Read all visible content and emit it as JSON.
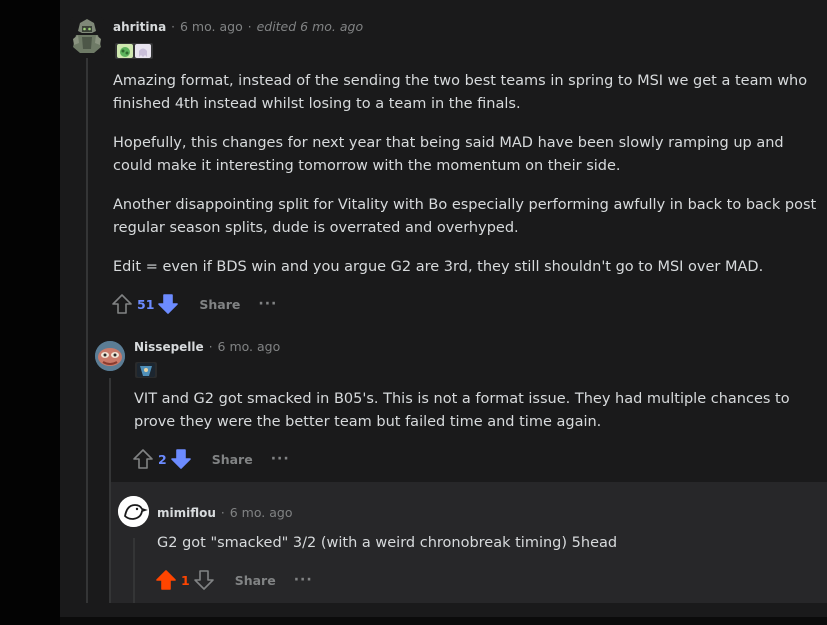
{
  "colors": {
    "background": "#030303",
    "panel": "#1a1a1b",
    "text": "#d7dadc",
    "muted": "#818384",
    "upvote_active": "#ff4500",
    "downvote_active": "#7193ff",
    "vote_blue": "#6c8bff"
  },
  "comments": [
    {
      "author": "ahritina",
      "separator": "·",
      "time": "6 mo. ago",
      "edited": "edited 6 mo. ago",
      "paragraphs": [
        "Amazing format, instead of the sending the two best teams in spring to MSI we get a team who finished 4th instead whilst losing to a team in the finals.",
        "Hopefully, this changes for next year that being said MAD have been slowly ramping up and could make it interesting tomorrow with the momentum on their side.",
        "Another disappointing split for Vitality with Bo especially performing awfully in back to back post regular season splits, dude is overrated and overhyped.",
        "Edit = even if BDS win and you argue G2 are 3rd, they still shouldn't go to MSI over MAD."
      ],
      "score": "51",
      "share_label": "Share",
      "more_label": "···",
      "vote_state": "downvoted"
    },
    {
      "author": "Nissepelle",
      "separator": "·",
      "time": "6 mo. ago",
      "paragraphs": [
        "VIT and G2 got smacked in B05's. This is not a format issue. They had multiple chances to prove they were the better team but failed time and time again."
      ],
      "score": "2",
      "share_label": "Share",
      "more_label": "···",
      "vote_state": "downvoted"
    },
    {
      "author": "mimiflou",
      "separator": "·",
      "time": "6 mo. ago",
      "paragraphs": [
        "G2 got \"smacked\" 3/2 (with a weird chronobreak timing) 5head"
      ],
      "score": "1",
      "share_label": "Share",
      "more_label": "···",
      "vote_state": "upvoted"
    }
  ]
}
